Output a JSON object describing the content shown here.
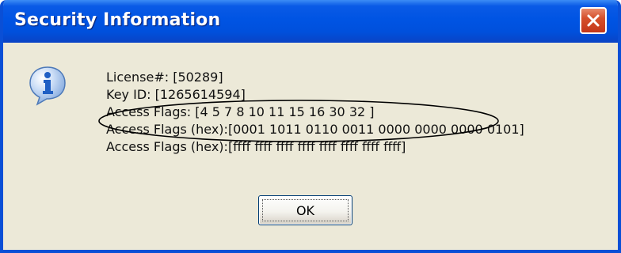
{
  "window": {
    "title": "Security Information",
    "close_icon": "close-icon"
  },
  "icon": {
    "name": "info-icon"
  },
  "lines": {
    "license": "License#: [50289]",
    "key_id": "Key ID: [1265614594]",
    "access_flags": "Access Flags: [4 5 7 8 10 11 15 16 30 32 ]",
    "access_flags_hex_1": "Access Flags (hex):[0001 1011 0110 0011 0000 0000 0000 0101]",
    "access_flags_hex_2": "Access Flags (hex):[ffff ffff ffff ffff ffff ffff ffff ffff]"
  },
  "annotation": {
    "shape": "ellipse-highlight"
  },
  "buttons": {
    "ok": "OK"
  },
  "colors": {
    "title_bar": "#0054e3",
    "dialog_bg": "#ece9d8",
    "close_button": "#d5502c",
    "info_icon": "#2f6fd0"
  }
}
